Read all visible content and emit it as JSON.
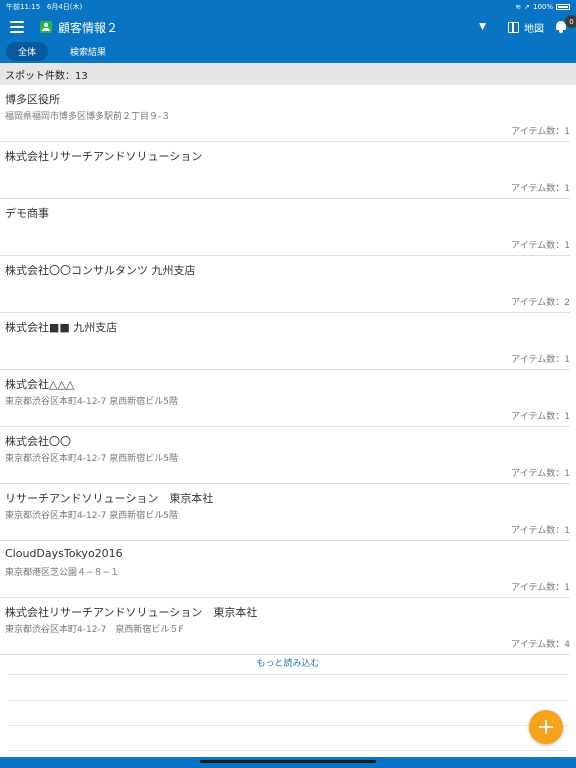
{
  "status": {
    "time": "午前11:15",
    "date": "6月4日(木)",
    "battery": "100%"
  },
  "header": {
    "title": "顧客情報２",
    "map_label": "地図",
    "notification_count": "0"
  },
  "tabs": [
    {
      "label": "全体",
      "active": true
    },
    {
      "label": "検索結果",
      "active": false
    }
  ],
  "spot_count": "スポット件数：13",
  "items": [
    {
      "name": "博多区役所",
      "address": "福岡県福岡市博多区博多駅前２丁目９-３",
      "count": "アイテム数：1"
    },
    {
      "name": "株式会社リサーチアンドソリューション",
      "address": "",
      "count": "アイテム数：1"
    },
    {
      "name": "デモ商事",
      "address": "",
      "count": "アイテム数：1"
    },
    {
      "name": "株式会社〇〇コンサルタンツ 九州支店",
      "address": "",
      "count": "アイテム数：2"
    },
    {
      "name": "株式会社■■ 九州支店",
      "address": "",
      "count": "アイテム数：1"
    },
    {
      "name": "株式会社△△△",
      "address": "東京都渋谷区本町4-12-7 泉西新宿ビル5階",
      "count": "アイテム数：1"
    },
    {
      "name": "株式会社〇〇",
      "address": "東京都渋谷区本町4-12-7 泉西新宿ビル5階",
      "count": "アイテム数：1"
    },
    {
      "name": "リサーチアンドソリューション　東京本社",
      "address": "東京都渋谷区本町4-12-7 泉西新宿ビル5階",
      "count": "アイテム数：1"
    },
    {
      "name": "CloudDaysTokyo2016",
      "address": "東京都港区芝公園４−８−１",
      "count": "アイテム数：1"
    },
    {
      "name": "株式会社リサーチアンドソリューション　東京本社",
      "address": "東京都渋谷区本町4-12-7　泉西新宿ビル５F",
      "count": "アイテム数：4"
    }
  ],
  "load_more": "もっと読み込む",
  "fab_label": "+"
}
